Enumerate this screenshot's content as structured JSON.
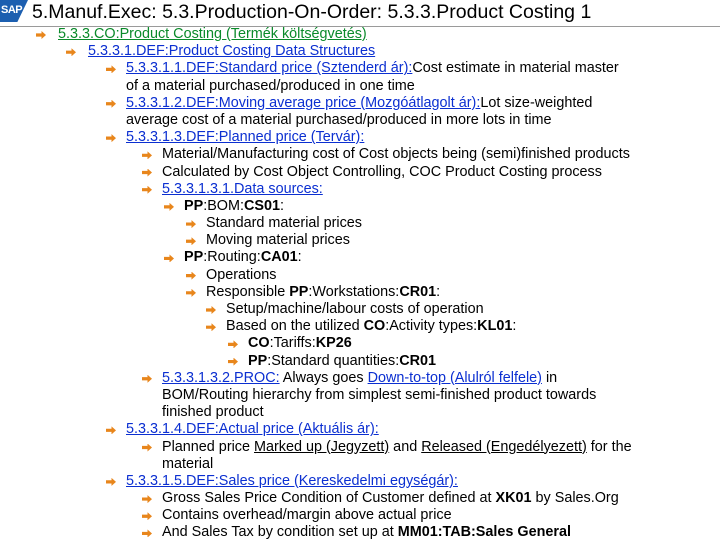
{
  "logo": "SAP",
  "title": "5.Manuf.Exec: 5.3.Production-On-Order: 5.3.3.Product Costing 1",
  "l1": "5.3.3.CO:Product Costing (Termék költségvetés)",
  "l2": "5.3.3.1.DEF:Product Costing Data Structures",
  "l3a": "5.3.3.1.1.DEF:Standard price (Sztenderd ár):",
  "l3b": "Cost estimate in material master",
  "l4": "of a material purchased/produced in one time",
  "l5a": "5.3.3.1.2.DEF:Moving average price (Mozgóátlagolt ár):",
  "l5b": "Lot size-weighted",
  "l6": "average cost of a material purchased/produced in more lots in time",
  "l7": "5.3.3.1.3.DEF:Planned price (Tervár):",
  "l8": "Material/Manufacturing cost of Cost objects being (semi)finished products",
  "l9": "Calculated by Cost Object Controlling, COC Product Costing process",
  "l10": "5.3.3.1.3.1.Data sources:",
  "l11a": "PP",
  "l11b": ":BOM:",
  "l11c": "CS01",
  "l11d": ":",
  "l12": "Standard material prices",
  "l13": "Moving material prices",
  "l14a": "PP",
  "l14b": ":Routing:",
  "l14c": "CA01",
  "l14d": ":",
  "l15": "Operations",
  "l16a": "Responsible ",
  "l16b": "PP",
  "l16c": ":Workstations:",
  "l16d": "CR01",
  "l16e": ":",
  "l17": "Setup/machine/labour costs of operation",
  "l18a": "Based on the utilized ",
  "l18b": "CO",
  "l18c": ":Activity types:",
  "l18d": "KL01",
  "l18e": ":",
  "l19a": "CO",
  "l19b": ":Tariffs:",
  "l19c": "KP26",
  "l20a": "PP",
  "l20b": ":Standard quantities:",
  "l20c": "CR01",
  "l21a": "5.3.3.1.3.2.PROC:",
  "l21b": " Always goes ",
  "l21c": "Down-to-top (Alulról felfele)",
  "l21d": " in",
  "l22": "BOM/Routing hierarchy from simplest semi-finished product towards",
  "l23": "finished product",
  "l24": "5.3.3.1.4.DEF:Actual price (Aktuális ár):",
  "l25a": "Planned price ",
  "l25b": "Marked up (Jegyzett)",
  "l25c": " and ",
  "l25d": "Released (Engedélyezett)",
  "l25e": " for the",
  "l26": "material",
  "l27": "5.3.3.1.5.DEF:Sales price (Kereskedelmi egységár):",
  "l28a": "Gross Sales Price Condition of Customer defined at ",
  "l28b": "XK01",
  "l28c": " by Sales.Org",
  "l29": "Contains overhead/margin above actual price",
  "l30a": "And Sales Tax by condition set up at ",
  "l30b": "MM01:TAB:Sales General",
  "colors": {
    "bullet": "#e8861c",
    "link": "#0b2fd1",
    "heading": "#0a8a2a",
    "logo": "#1c5fb0"
  }
}
